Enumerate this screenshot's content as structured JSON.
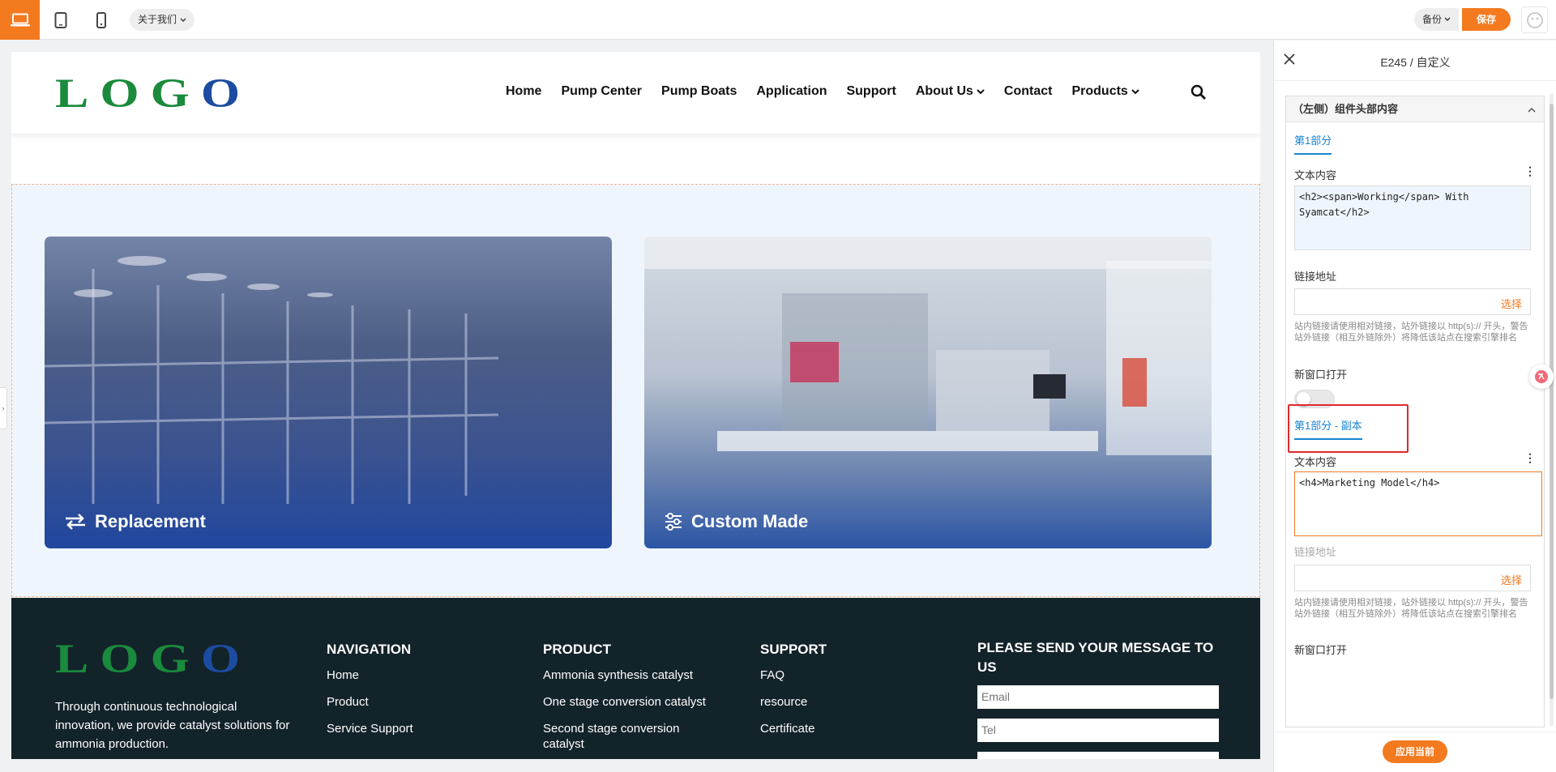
{
  "topbar": {
    "page_selector": "关于我们",
    "backup_label": "备份",
    "save_label": "保存"
  },
  "site": {
    "logo": "LOGO",
    "nav": [
      "Home",
      "Pump Center",
      "Pump Boats",
      "Application",
      "Support",
      "About Us",
      "Contact",
      "Products"
    ],
    "cards": [
      {
        "label": "Replacement",
        "icon": "swap-arrows-icon"
      },
      {
        "label": "Custom Made",
        "icon": "sliders-icon"
      }
    ]
  },
  "footer": {
    "logo": "LOGO",
    "about": "Through continuous technological innovation, we provide catalyst solutions for ammonia production.",
    "navigation": {
      "title": "NAVIGATION",
      "items": [
        "Home",
        "Product",
        "Service Support"
      ]
    },
    "product": {
      "title": "PRODUCT",
      "items": [
        "Ammonia synthesis catalyst",
        "One stage conversion catalyst",
        "Second stage conversion catalyst"
      ]
    },
    "support": {
      "title": "SUPPORT",
      "items": [
        "FAQ",
        "resource",
        "Certificate"
      ]
    },
    "message": {
      "title": "PLEASE SEND YOUR MESSAGE TO US",
      "email_placeholder": "Email",
      "tel_placeholder": "Tel"
    }
  },
  "panel": {
    "title": "E245 / 自定义",
    "group_title": "（左侧）组件头部内容",
    "part1": {
      "label": "第1部分",
      "text_label": "文本内容",
      "text_value": "<h2><span>Working</span> With Syamcat</h2>",
      "link_label": "链接地址",
      "choose": "选择",
      "hint": "站内链接请使用相对链接，站外链接以 http(s):// 开头，警告站外链接（相互外链除外）将降低该站点在搜索引擎排名",
      "new_window": "新窗口打开"
    },
    "part1_copy": {
      "label": "第1部分 - 副本",
      "text_label": "文本内容",
      "text_value": "<h4>Marketing Model</h4>",
      "link_label": "链接地址",
      "choose": "选择",
      "hint": "站内链接请使用相对链接，站外链接以 http(s):// 开头，警告站外链接（相互外链除外）将降低该站点在搜索引擎排名",
      "new_window": "新窗口打开"
    },
    "apply_label": "应用当前"
  },
  "colors": {
    "accent": "#f47a1f",
    "link_blue": "#1784d4",
    "footer_bg": "#13232a",
    "section_bg": "#eff5fc",
    "highlight_red": "#e0282e"
  }
}
